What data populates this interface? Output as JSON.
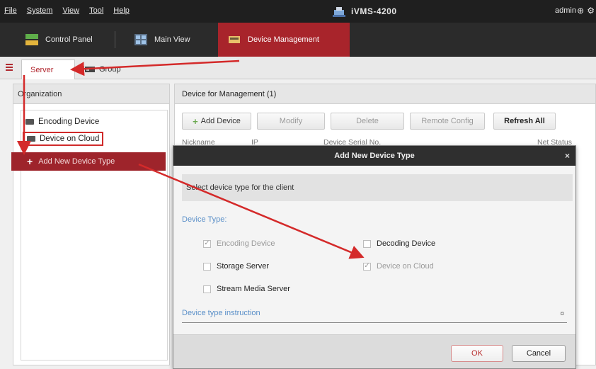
{
  "menubar": {
    "menus": [
      "File",
      "System",
      "View",
      "Tool",
      "Help"
    ],
    "app_title": "iVMS-4200",
    "user": "admin"
  },
  "modules": {
    "control_panel": "Control Panel",
    "main_view": "Main View",
    "device_management": "Device Management"
  },
  "subtabs": {
    "server": "Server",
    "group": "Group"
  },
  "left_pane": {
    "title": "Organization",
    "items": [
      "Encoding Device",
      "Device on Cloud"
    ],
    "add_type": "Add New Device Type"
  },
  "right_pane": {
    "title": "Device for Management (1)",
    "toolbar": {
      "add": "Add Device",
      "modify": "Modify",
      "delete": "Delete",
      "remote_config": "Remote Config",
      "refresh_all": "Refresh All"
    },
    "columns": [
      "Nickname",
      "IP",
      "Device Serial No.",
      "Net Status"
    ]
  },
  "dialog": {
    "title": "Add New Device Type",
    "message": "Select device type for the client",
    "device_type_label": "Device Type:",
    "options": [
      {
        "label": "Encoding Device",
        "checked": true,
        "disabled": true
      },
      {
        "label": "Decoding Device",
        "checked": false,
        "disabled": false
      },
      {
        "label": "Storage Server",
        "checked": false,
        "disabled": false
      },
      {
        "label": "Device on Cloud",
        "checked": true,
        "disabled": true
      },
      {
        "label": "Stream Media Server",
        "checked": false,
        "disabled": false
      }
    ],
    "instruction": "Device type instruction",
    "ok": "OK",
    "cancel": "Cancel"
  },
  "colors": {
    "accent_red": "#a8242b",
    "annotation_red": "#d42a2a",
    "link_blue": "#5a8fc8"
  }
}
